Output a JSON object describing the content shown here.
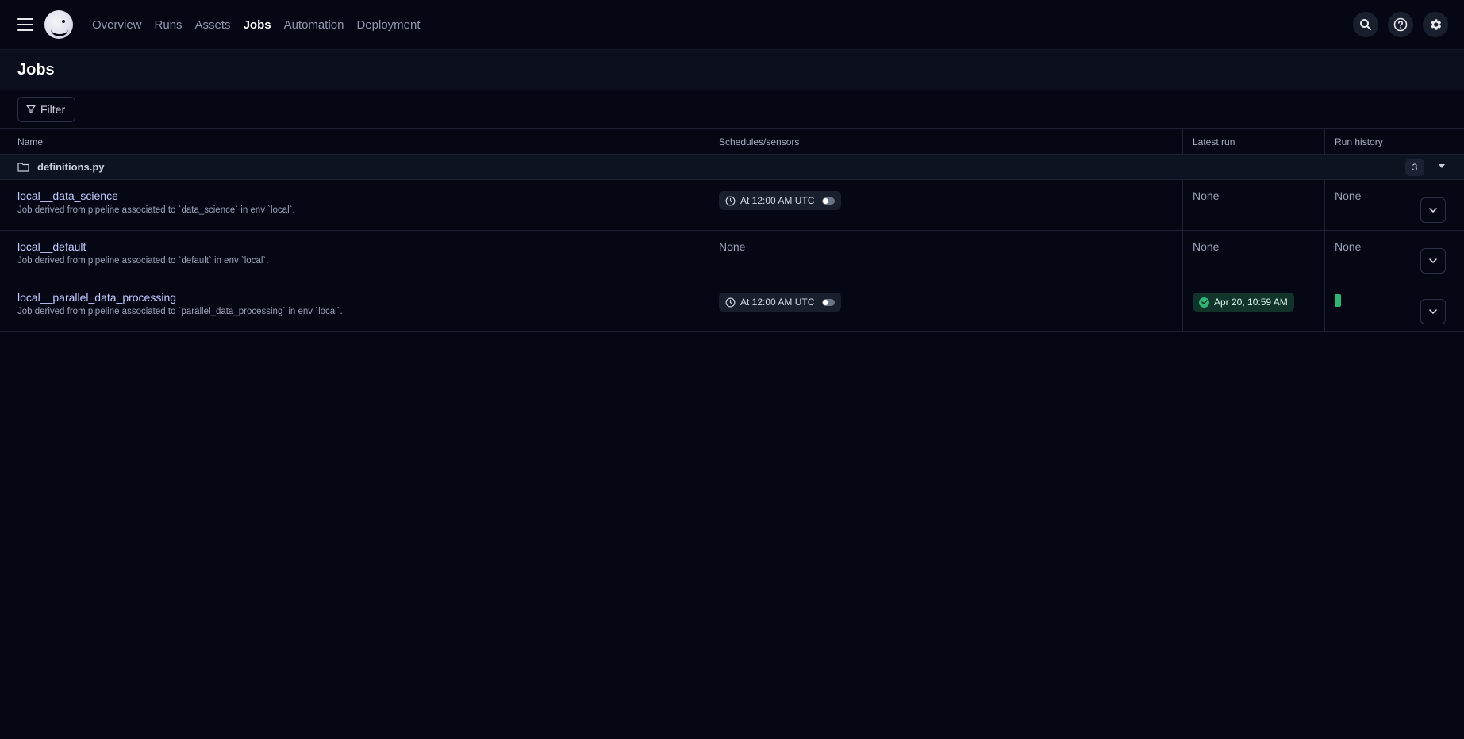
{
  "nav": {
    "items": [
      {
        "label": "Overview",
        "active": false
      },
      {
        "label": "Runs",
        "active": false
      },
      {
        "label": "Assets",
        "active": false
      },
      {
        "label": "Jobs",
        "active": true
      },
      {
        "label": "Automation",
        "active": false
      },
      {
        "label": "Deployment",
        "active": false
      }
    ]
  },
  "page": {
    "title": "Jobs"
  },
  "filter": {
    "label": "Filter"
  },
  "table": {
    "headers": [
      "Name",
      "Schedules/sensors",
      "Latest run",
      "Run history"
    ],
    "group": {
      "name": "definitions.py",
      "count": "3"
    },
    "rows": [
      {
        "name": "local__data_science",
        "description": "Job derived from pipeline associated to `data_science` in env `local`.",
        "schedule": "At 12:00 AM UTC",
        "latest_run": "None",
        "run_history": "None"
      },
      {
        "name": "local__default",
        "description": "Job derived from pipeline associated to `default` in env `local`.",
        "schedule": "None",
        "latest_run": "None",
        "run_history": "None"
      },
      {
        "name": "local__parallel_data_processing",
        "description": "Job derived from pipeline associated to `parallel_data_processing` in env `local`.",
        "schedule": "At 12:00 AM UTC",
        "latest_run": "Apr 20, 10:59 AM",
        "latest_run_status": "success",
        "run_history": ""
      }
    ]
  },
  "colors": {
    "background": "#050814",
    "accent_link": "#c3c9ff",
    "success": "#2bb673"
  }
}
